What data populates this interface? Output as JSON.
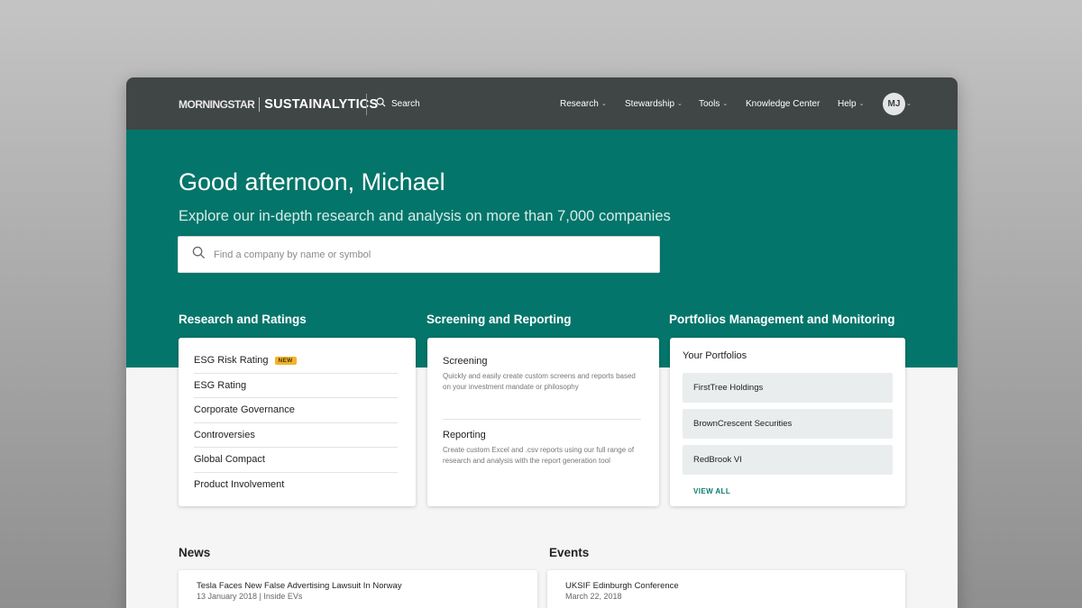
{
  "header": {
    "brand_morningstar": "MORNINGSTAR",
    "brand_sustainalytics": "SUSTAINALYTICS",
    "search_label": "Search",
    "nav": [
      {
        "label": "Research",
        "has_dropdown": true
      },
      {
        "label": "Stewardship",
        "has_dropdown": true
      },
      {
        "label": "Tools",
        "has_dropdown": true
      },
      {
        "label": "Knowledge Center",
        "has_dropdown": false
      },
      {
        "label": "Help",
        "has_dropdown": true
      }
    ],
    "avatar_initials": "MJ"
  },
  "hero": {
    "greeting": "Good afternoon, Michael",
    "subtitle": "Explore our in-depth research and analysis on more than 7,000 companies",
    "search_placeholder": "Find a company by name or symbol"
  },
  "research_ratings": {
    "title": "Research and Ratings",
    "items": [
      {
        "label": "ESG Risk Rating",
        "badge": "NEW"
      },
      {
        "label": "ESG Rating"
      },
      {
        "label": "Corporate Governance"
      },
      {
        "label": "Controversies"
      },
      {
        "label": "Global Compact"
      },
      {
        "label": "Product Involvement"
      }
    ]
  },
  "screening_reporting": {
    "title": "Screening and Reporting",
    "blocks": [
      {
        "title": "Screening",
        "description": "Quickly and easily create custom screens and reports based on your investment mandate or philosophy"
      },
      {
        "title": "Reporting",
        "description": "Create custom Excel and .csv reports using our full range of research and analysis with the report generation tool"
      }
    ]
  },
  "portfolios": {
    "title": "Portfolios Management and Monitoring",
    "heading": "Your Portfolios",
    "items": [
      "FirstTree Holdings",
      "BrownCrescent Securities",
      "RedBrook VI"
    ],
    "view_all": "VIEW ALL"
  },
  "news": {
    "title": "News",
    "items": [
      {
        "headline": "Tesla Faces New False Advertising Lawsuit In Norway",
        "meta": "13 January 2018 | Inside EVs"
      }
    ]
  },
  "events": {
    "title": "Events",
    "items": [
      {
        "headline": "UKSIF Edinburgh Conference",
        "meta": "March 22, 2018"
      }
    ]
  },
  "colors": {
    "topbar": "#404545",
    "hero_teal": "#04756a",
    "badge_yellow": "#f2b32a",
    "link_teal": "#0a7a6d"
  }
}
